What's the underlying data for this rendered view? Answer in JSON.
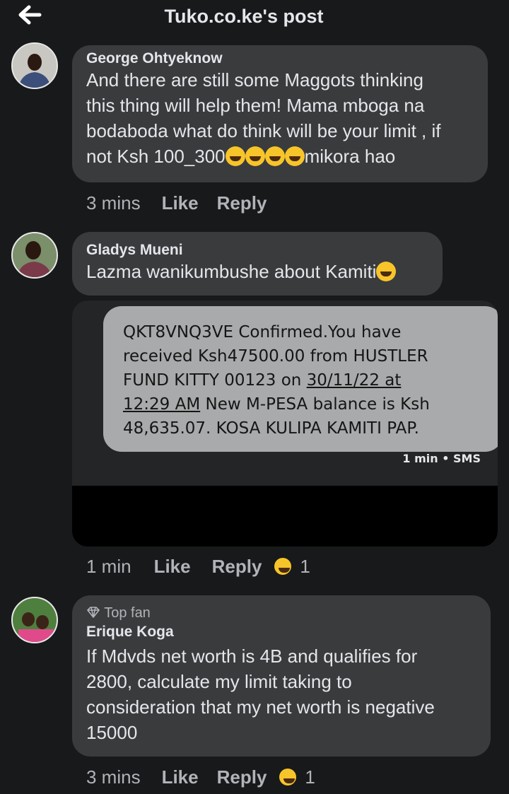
{
  "header": {
    "title": "Tuko.co.ke's post",
    "back_icon": "arrow-left-icon"
  },
  "comments": [
    {
      "author": "George Ohtyeknow",
      "text_lines": [
        "And there are still some Maggots thinking",
        "this thing will help them! Mama mboga na",
        "bodaboda what do think will be your limit , if"
      ],
      "last_line_prefix": "not Ksh 100_300",
      "last_line_suffix": "mikora hao",
      "emoji": "😂",
      "time": "3 mins",
      "like": "Like",
      "reply": "Reply"
    },
    {
      "author": "Gladys Mueni",
      "text": "Lazma wanikumbushe about Kamiti",
      "emoji": "🤔",
      "time": "1 min",
      "like": "Like",
      "reply": "Reply",
      "reaction_emoji": "😆",
      "reaction_count": "1",
      "sms": {
        "line1": "QKT8VNQ3VE Confirmed.You have",
        "line2": "received Ksh47500.00 from HUSTLER",
        "line3_a": "FUND KITTY 00123 on ",
        "line3_b": "30/11/22 at",
        "line4_a": "12:29 AM",
        "line4_b": " New M-PESA balance is Ksh",
        "line5": "48,635.07. KOSA KULIPA KAMITI PAP.",
        "meta": "1 min • SMS"
      }
    },
    {
      "badge": "Top fan",
      "author": "Erique Koga",
      "text_lines": [
        "If Mdvds net worth  is 4B and qualifies for",
        "2800, calculate  my limit taking  to",
        "consideration  that my net worth is negative",
        "15000"
      ],
      "time": "3 mins",
      "like": "Like",
      "reply": "Reply",
      "reaction_emoji": "😆",
      "reaction_count": "1"
    }
  ],
  "colors": {
    "background": "#18191a",
    "bubble": "#3a3b3c",
    "text": "#e4e6eb",
    "muted": "#b0b3b8"
  }
}
